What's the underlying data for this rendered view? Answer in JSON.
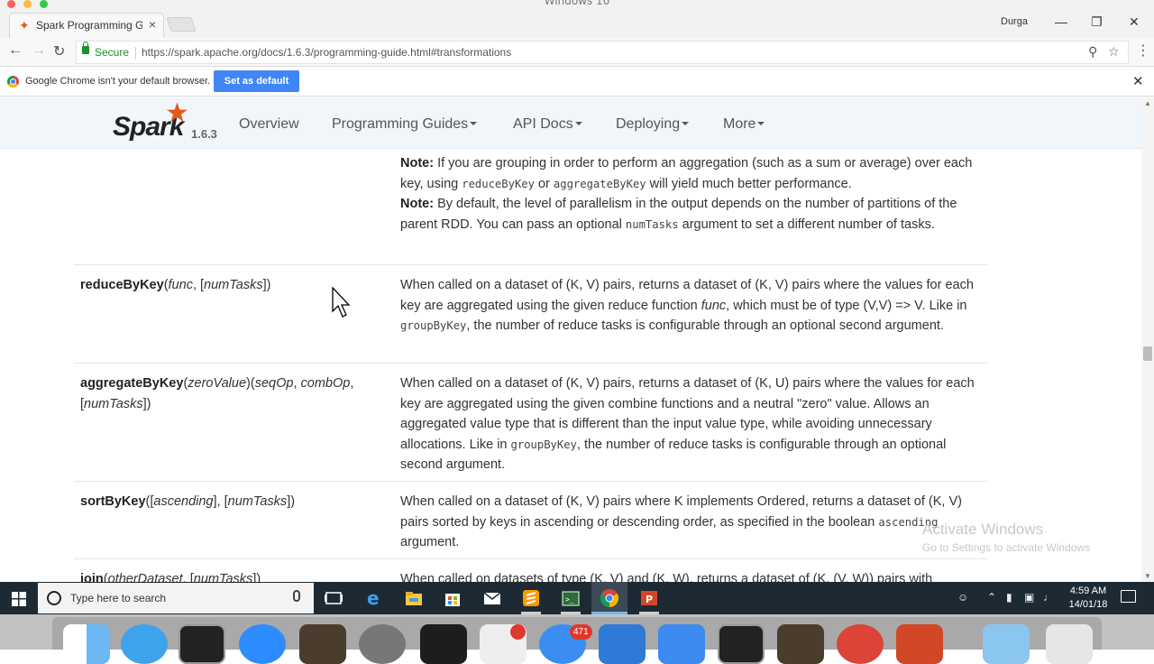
{
  "window": {
    "title": "Windows 10",
    "profile": "Durga"
  },
  "tab": {
    "title": "Spark Programming Gui…",
    "close": "×"
  },
  "toolbar": {
    "secure_label": "Secure",
    "url": "https://spark.apache.org/docs/1.6.3/programming-guide.html#transformations"
  },
  "infobar": {
    "message": "Google Chrome isn't your default browser.",
    "button": "Set as default"
  },
  "spark_nav": {
    "logo_text": "Spark",
    "version": "1.6.3",
    "items": [
      "Overview",
      "Programming Guides",
      "API Docs",
      "Deploying",
      "More"
    ]
  },
  "content": {
    "top_row": {
      "note1_label": "Note:",
      "note1_a": " If you are grouping in order to perform an aggregation (such as a sum or average) over each key, using ",
      "note1_code1": "reduceByKey",
      "note1_b": " or ",
      "note1_code2": "aggregateByKey",
      "note1_c": " will yield much better performance.",
      "note2_label": "Note:",
      "note2_a": " By default, the level of parallelism in the output depends on the number of partitions of the parent RDD. You can pass an optional ",
      "note2_code": "numTasks",
      "note2_b": " argument to set a different number of tasks."
    },
    "reduceByKey": {
      "name": "reduceByKey",
      "sig_a": "(",
      "p1": "func",
      "sig_b": ", [",
      "p2": "numTasks",
      "sig_c": "])",
      "d1": "When called on a dataset of (K, V) pairs, returns a dataset of (K, V) pairs where the values for each key are aggregated using the given reduce function ",
      "d_func": "func",
      "d2": ", which must be of type (V,V) => V. Like in ",
      "d_code": "groupByKey",
      "d3": ", the number of reduce tasks is configurable through an optional second argument."
    },
    "aggregateByKey": {
      "name": "aggregateByKey",
      "sig_a": "(",
      "p1": "zeroValue",
      "sig_b": ")(",
      "p2": "seqOp",
      "sig_c": ", ",
      "p3": "combOp",
      "sig_d": ", [",
      "p4": "numTasks",
      "sig_e": "])",
      "d1": "When called on a dataset of (K, V) pairs, returns a dataset of (K, U) pairs where the values for each key are aggregated using the given combine functions and a neutral \"zero\" value. Allows an aggregated value type that is different than the input value type, while avoiding unnecessary allocations. Like in ",
      "d_code": "groupByKey",
      "d2": ", the number of reduce tasks is configurable through an optional second argument."
    },
    "sortByKey": {
      "name": "sortByKey",
      "sig_a": "([",
      "p1": "ascending",
      "sig_b": "], [",
      "p2": "numTasks",
      "sig_c": "])",
      "d1": "When called on a dataset of (K, V) pairs where K implements Ordered, returns a dataset of (K, V) pairs sorted by keys in ascending or descending order, as specified in the boolean ",
      "d_code": "ascending",
      "d2": " argument."
    },
    "join": {
      "name": "join",
      "sig_a": "(",
      "p1": "otherDataset",
      "sig_b": ", [",
      "p2": "numTasks",
      "sig_c": "])",
      "d1": "When called on datasets of type (K, V) and (K, W), returns a dataset of (K, (V, W)) pairs with"
    }
  },
  "watermark": {
    "line1": "Activate Windows",
    "line2": "Go to Settings to activate Windows"
  },
  "taskbar": {
    "search_placeholder": "Type here to search",
    "time": "4:59 AM",
    "date": "14/01/18"
  },
  "dock": {
    "badge": "471"
  },
  "colors": {
    "spark_orange": "#e25a1c",
    "chrome_blue": "#4285f4",
    "secure_green": "#1a8f2a",
    "taskbar": "#1e2a33"
  }
}
